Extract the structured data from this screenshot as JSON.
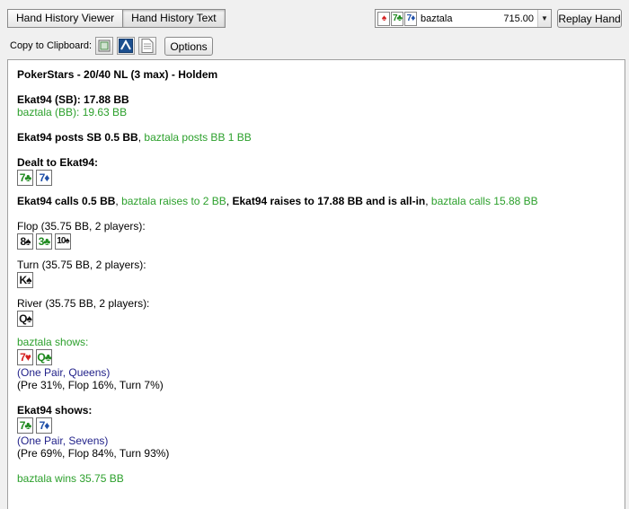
{
  "tabs": [
    {
      "label": "Hand History Viewer"
    },
    {
      "label": "Hand History Text"
    }
  ],
  "hand_select": {
    "cards": [
      {
        "rank": "",
        "suit": "♠",
        "color": "#d42020"
      },
      {
        "rank": "7",
        "suit": "♣",
        "color": "#1f8a1f"
      },
      {
        "rank": "7",
        "suit": "♦",
        "color": "#1f4fa8"
      }
    ],
    "player": "baztala",
    "amount": "715.00",
    "arrow_icon": "chevron-down-icon"
  },
  "replay_label": "Replay Hand",
  "clipboard_label": "Copy to Clipboard:",
  "options_label": "Options",
  "history": {
    "header": "PokerStars - 20/40 NL (3 max) - Holdem",
    "seat1": "Ekat94 (SB): 17.88 BB",
    "seat2": "baztala (BB): 19.63 BB",
    "post1": "Ekat94 posts SB 0.5 BB",
    "post_sep": ", ",
    "post2": "baztala posts BB 1 BB",
    "dealt": "Dealt to Ekat94:",
    "dealt_cards": [
      {
        "rank": "7",
        "suit": "♣",
        "color": "#1f8a1f"
      },
      {
        "rank": "7",
        "suit": "♦",
        "color": "#1f4fa8"
      }
    ],
    "action1": "Ekat94 calls 0.5 BB",
    "action2": "baztala raises to 2 BB",
    "action3": "Ekat94 raises to 17.88 BB and is all-in",
    "action4": "baztala calls 15.88 BB",
    "sep": ", ",
    "flop_label": "Flop (35.75 BB, 2 players):",
    "flop_cards": [
      {
        "rank": "8",
        "suit": "♠",
        "color": "#111111"
      },
      {
        "rank": "3",
        "suit": "♣",
        "color": "#1f8a1f"
      },
      {
        "rank": "10",
        "suit": "♠",
        "color": "#111111"
      }
    ],
    "turn_label": "Turn (35.75 BB, 2 players):",
    "turn_cards": [
      {
        "rank": "K",
        "suit": "♠",
        "color": "#111111"
      }
    ],
    "river_label": "River (35.75 BB, 2 players):",
    "river_cards": [
      {
        "rank": "Q",
        "suit": "♠",
        "color": "#111111"
      }
    ],
    "show1_label": "baztala shows:",
    "show1_cards": [
      {
        "rank": "7",
        "suit": "♥",
        "color": "#d42020"
      },
      {
        "rank": "Q",
        "suit": "♣",
        "color": "#1f8a1f"
      }
    ],
    "show1_hand": "(One Pair, Queens)",
    "show1_equity": "(Pre 31%, Flop 16%, Turn 7%)",
    "show2_label": "Ekat94 shows:",
    "show2_cards": [
      {
        "rank": "7",
        "suit": "♣",
        "color": "#1f8a1f"
      },
      {
        "rank": "7",
        "suit": "♦",
        "color": "#1f4fa8"
      }
    ],
    "show2_hand": "(One Pair, Sevens)",
    "show2_equity": "(Pre 69%, Flop 84%, Turn 93%)",
    "winner": "baztala wins 35.75 BB"
  }
}
